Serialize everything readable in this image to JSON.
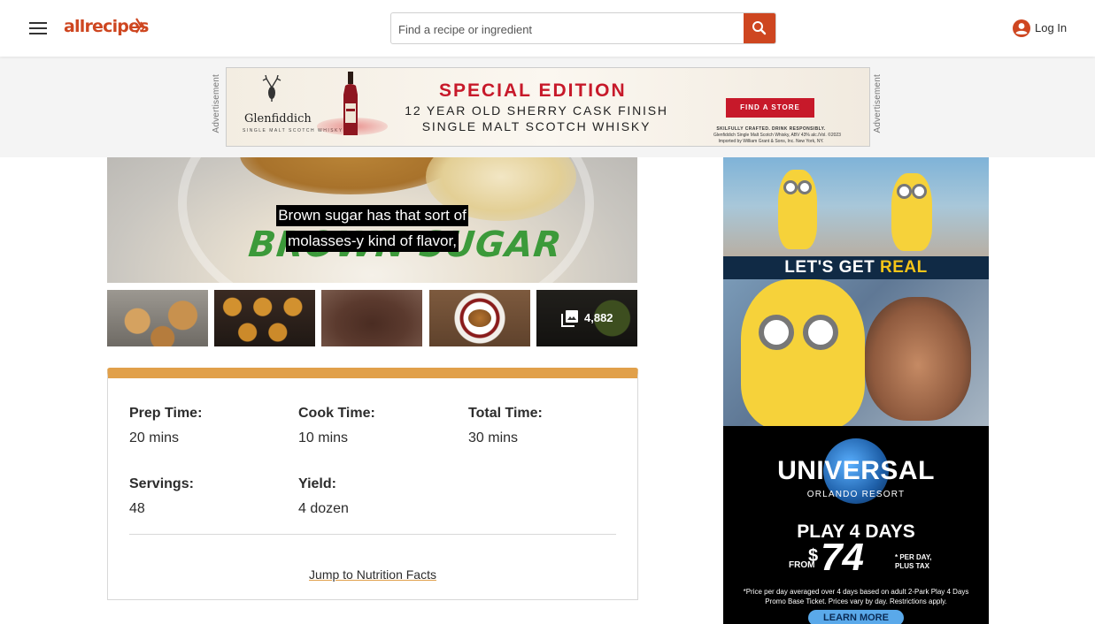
{
  "header": {
    "menu_icon": "hamburger-menu-icon",
    "logo_text": "allrecipes",
    "search_placeholder": "Find a recipe or ingredient",
    "search_icon": "search-icon",
    "login_label": "Log In",
    "login_icon": "user-account-icon",
    "brand_color": "#ce4620"
  },
  "top_ad": {
    "label_left": "Advertisement",
    "label_right": "Advertisement",
    "brand": "Glenfiddich",
    "brand_sub": "SINGLE MALT SCOTCH WHISKY",
    "headline": "SPECIAL EDITION",
    "line1": "12 YEAR OLD SHERRY CASK FINISH",
    "line2": "SINGLE MALT SCOTCH WHISKY",
    "cta": "FIND A STORE",
    "fine1": "SKILFULLY CRAFTED. DRINK RESPONSIBLY.",
    "fine2": "Glenfiddich Single Malt Scotch Whisky, ABV 43% alc./Vol. ©2023",
    "fine3": "Imported by William Grant & Sons, Inc. New York, NY.",
    "accent_color": "#c7192a"
  },
  "video": {
    "overlay_title": "BROWN SUGAR",
    "caption_line1": "Brown sugar has that sort of",
    "caption_line2": "molasses-y kind of flavor,"
  },
  "gallery": {
    "photo_count": "4,882",
    "icon": "photo-gallery-icon"
  },
  "details": {
    "accent_color": "#e1a04a",
    "prep_label": "Prep Time:",
    "prep_value": "20 mins",
    "cook_label": "Cook Time:",
    "cook_value": "10 mins",
    "total_label": "Total Time:",
    "total_value": "30 mins",
    "servings_label": "Servings:",
    "servings_value": "48",
    "yield_label": "Yield:",
    "yield_value": "4 dozen",
    "jump_link": "Jump to Nutrition Facts"
  },
  "side_ad": {
    "slogan_prefix": "LET'S GET ",
    "slogan_highlight": "REAL",
    "brand": "UNIVERSAL",
    "brand_sub": "ORLANDO RESORT",
    "offer": "PLAY 4 DAYS",
    "from": "FROM",
    "currency": "$",
    "price": "74",
    "per_day_line1": "* PER DAY,",
    "per_day_line2": "PLUS TAX",
    "fine_print": "*Price per day averaged over 4 days based on adult 2-Park Play 4 Days Promo Base Ticket. Prices vary by day. Restrictions apply.",
    "cta": "LEARN MORE"
  }
}
